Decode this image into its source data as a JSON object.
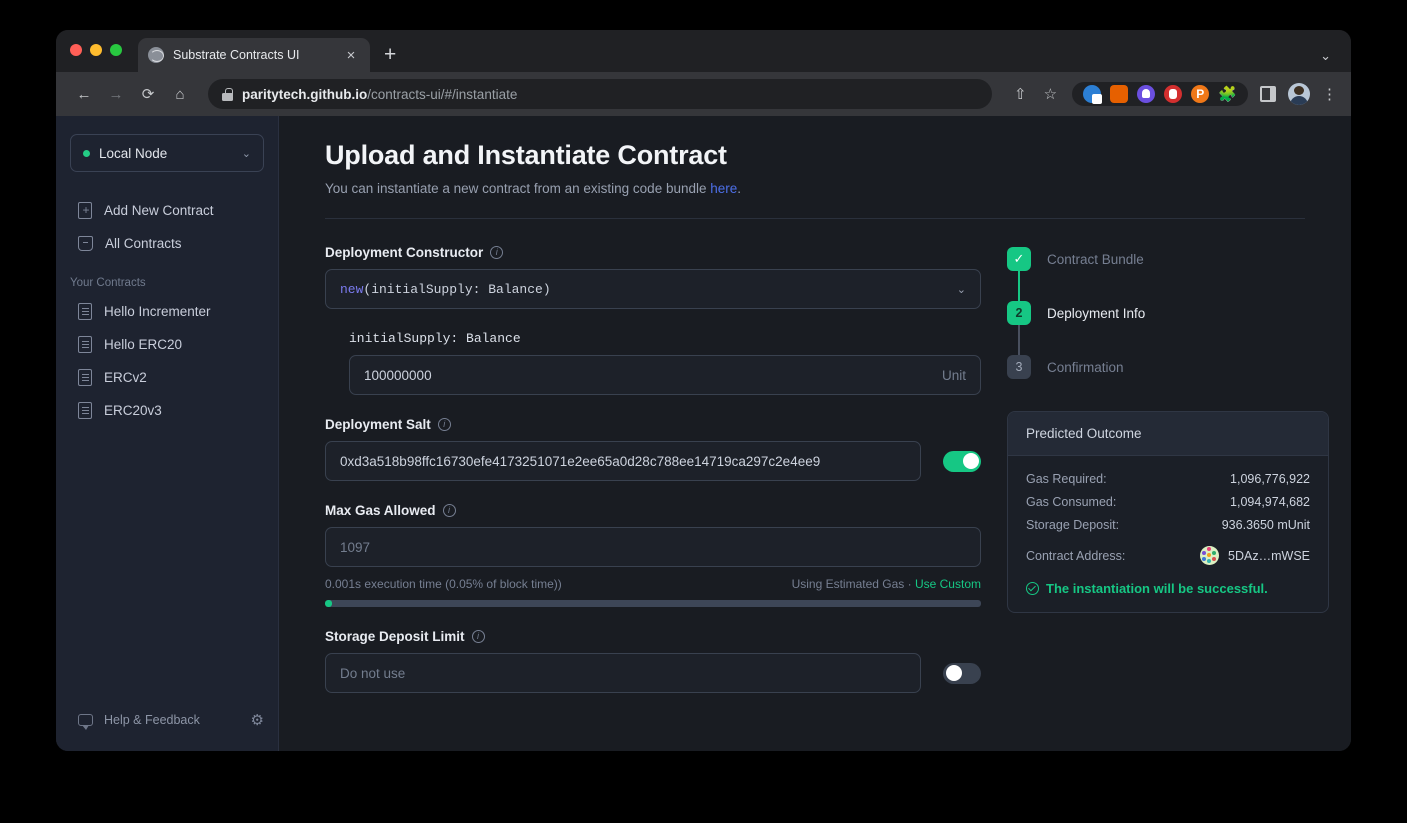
{
  "browser": {
    "tab": {
      "title": "Substrate Contracts UI",
      "favicon": "globe-icon",
      "close": "×"
    },
    "new_tab": "+",
    "tabstrip_caret": "⌄",
    "nav": {
      "back": "←",
      "forward": "→",
      "reload": "⟳",
      "home": "⌂"
    },
    "url": {
      "host": "paritytech.github.io",
      "path": "/contracts-ui/#/instantiate"
    },
    "actions": {
      "share": "⇧",
      "bookmark": "☆",
      "puzzle": "🧩",
      "menu": "⋮"
    },
    "extensions": [
      {
        "name": "lock-extension-icon",
        "glyph": ""
      },
      {
        "name": "metamask-extension-icon",
        "glyph": ""
      },
      {
        "name": "ghost-extension-icon",
        "glyph": ""
      },
      {
        "name": "ublock-extension-icon",
        "glyph": ""
      },
      {
        "name": "polkadot-extension-icon",
        "glyph": "P"
      }
    ]
  },
  "sidebar": {
    "node": {
      "label": "Local Node",
      "caret": "⌄",
      "status_color": "#24cc85"
    },
    "nav_items": [
      {
        "label": "Add New Contract",
        "icon": "document-plus-icon"
      },
      {
        "label": "All Contracts",
        "icon": "archive-icon"
      }
    ],
    "section_title": "Your Contracts",
    "contracts": [
      {
        "label": "Hello Incrementer",
        "icon": "document-icon"
      },
      {
        "label": "Hello ERC20",
        "icon": "document-icon"
      },
      {
        "label": "ERCv2",
        "icon": "document-icon"
      },
      {
        "label": "ERC20v3",
        "icon": "document-icon"
      }
    ],
    "footer": {
      "help_label": "Help & Feedback",
      "chat_icon": "chat-bubble-icon",
      "gear": "⚙"
    }
  },
  "main": {
    "title": "Upload and Instantiate Contract",
    "subtitle_before": "You can instantiate a new contract from an existing code bundle ",
    "subtitle_link": "here",
    "subtitle_after": ".",
    "fields": {
      "constructor": {
        "label": "Deployment Constructor",
        "info": "i",
        "keyword": "new",
        "signature": "(initialSupply: Balance)",
        "caret": "⌄"
      },
      "initial_supply": {
        "label": "initialSupply: Balance",
        "value": "100000000",
        "unit": "Unit"
      },
      "salt": {
        "label": "Deployment Salt",
        "info": "i",
        "value": "0xd3a518b98ffc16730efe4173251071e2ee65a0d28c788ee14719ca297c2e4ee9",
        "toggle_state": "on"
      },
      "max_gas": {
        "label": "Max Gas Allowed",
        "info": "i",
        "value": "1097",
        "helper": "0.001s execution time (0.05% of block time))",
        "mode_text": "Using Estimated Gas",
        "separator": "·",
        "custom_link": "Use Custom",
        "progress_percent": 1
      },
      "storage_deposit_limit": {
        "label": "Storage Deposit Limit",
        "info": "i",
        "placeholder": "Do not use",
        "toggle_state": "off"
      }
    }
  },
  "stepper": {
    "steps": [
      {
        "badge": "✓",
        "label": "Contract Bundle",
        "state": "done"
      },
      {
        "badge": "2",
        "label": "Deployment Info",
        "state": "active"
      },
      {
        "badge": "3",
        "label": "Confirmation",
        "state": "idle"
      }
    ]
  },
  "outcome": {
    "title": "Predicted Outcome",
    "rows": [
      {
        "key": "Gas Required:",
        "value": "1,096,776,922"
      },
      {
        "key": "Gas Consumed:",
        "value": "1,094,974,682"
      },
      {
        "key": "Storage Deposit:",
        "value": "936.3650 mUnit"
      }
    ],
    "address_key": "Contract Address:",
    "address_value": "5DAz…mWSE",
    "status": "The instantiation will be successful."
  },
  "colors": {
    "accent_green": "#16c784",
    "link_blue": "#4d6fe8",
    "keyword_purple": "#7b7bef",
    "sidebar_bg": "#1e2330",
    "main_bg": "#191c22"
  }
}
